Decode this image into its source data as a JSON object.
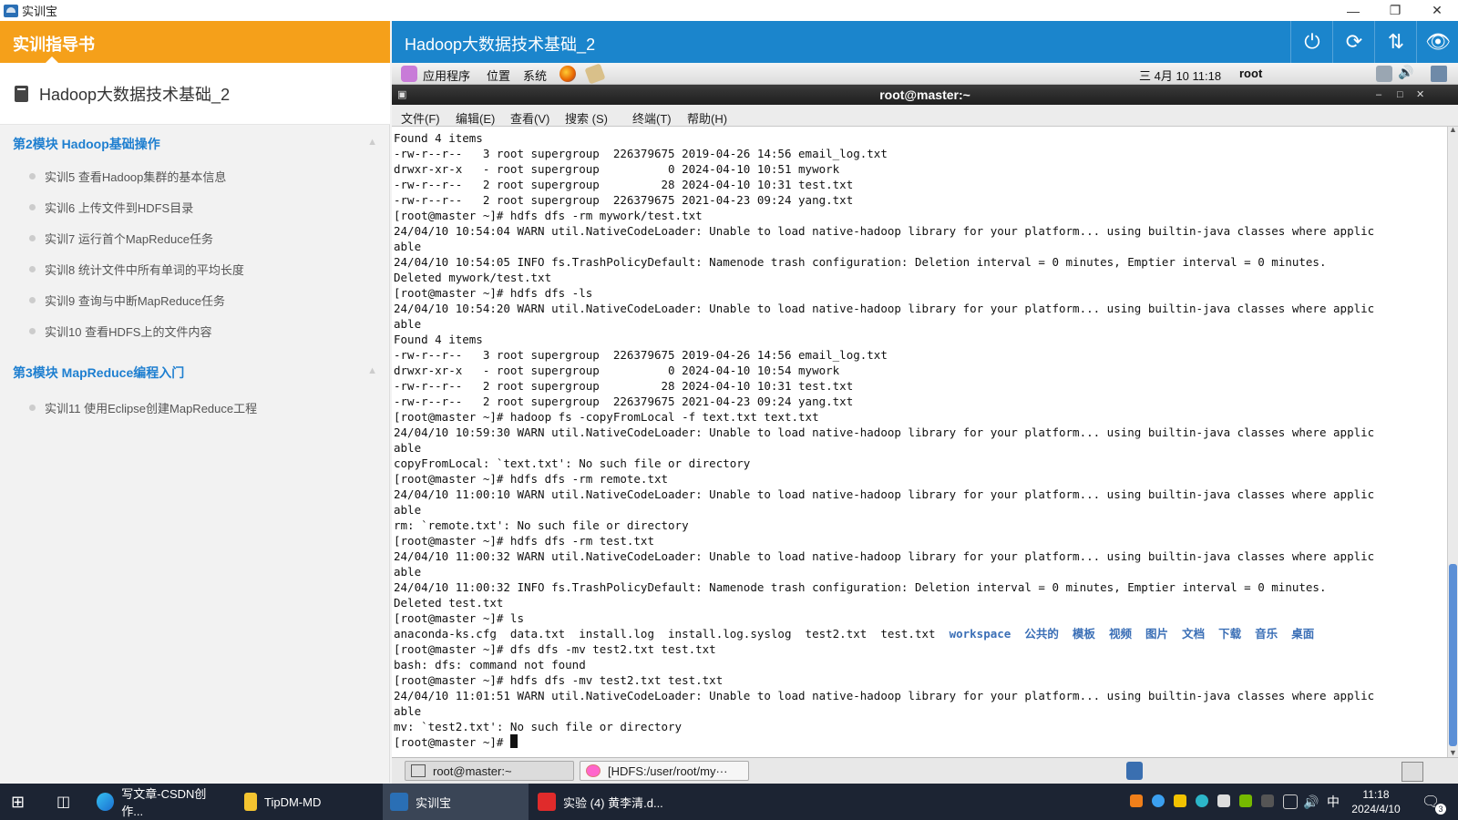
{
  "window": {
    "title": "实训宝"
  },
  "guide": {
    "header": "实训指导书",
    "doc_title": "Hadoop大数据技术基础_2",
    "modules": [
      {
        "title": "第2模块 Hadoop基础操作",
        "lessons": [
          "实训5 查看Hadoop集群的基本信息",
          "实训6 上传文件到HDFS目录",
          "实训7 运行首个MapReduce任务",
          "实训8 统计文件中所有单词的平均长度",
          "实训9 查询与中断MapReduce任务",
          "实训10 查看HDFS上的文件内容"
        ]
      },
      {
        "title": "第3模块 MapReduce编程入门",
        "lessons": [
          "实训11 使用Eclipse创建MapReduce工程"
        ]
      }
    ]
  },
  "vm": {
    "title": "Hadoop大数据技术基础_2"
  },
  "gnome_panel": {
    "apps": "应用程序",
    "places": "位置",
    "system": "系统",
    "datetime": "三 4月 10 11:18",
    "user": "root"
  },
  "terminal": {
    "title": "root@master:~",
    "menu": [
      "文件(F)",
      "编辑(E)",
      "查看(V)",
      "搜索 (S)",
      "终端(T)",
      "帮助(H)"
    ],
    "lines": [
      "Found 4 items",
      "-rw-r--r--   3 root supergroup  226379675 2019-04-26 14:56 email_log.txt",
      "drwxr-xr-x   - root supergroup          0 2024-04-10 10:51 mywork",
      "-rw-r--r--   2 root supergroup         28 2024-04-10 10:31 test.txt",
      "-rw-r--r--   2 root supergroup  226379675 2021-04-23 09:24 yang.txt",
      "[root@master ~]# hdfs dfs -rm mywork/test.txt",
      "24/04/10 10:54:04 WARN util.NativeCodeLoader: Unable to load native-hadoop library for your platform... using builtin-java classes where applic",
      "able",
      "24/04/10 10:54:05 INFO fs.TrashPolicyDefault: Namenode trash configuration: Deletion interval = 0 minutes, Emptier interval = 0 minutes.",
      "Deleted mywork/test.txt",
      "[root@master ~]# hdfs dfs -ls",
      "24/04/10 10:54:20 WARN util.NativeCodeLoader: Unable to load native-hadoop library for your platform... using builtin-java classes where applic",
      "able",
      "Found 4 items",
      "-rw-r--r--   3 root supergroup  226379675 2019-04-26 14:56 email_log.txt",
      "drwxr-xr-x   - root supergroup          0 2024-04-10 10:54 mywork",
      "-rw-r--r--   2 root supergroup         28 2024-04-10 10:31 test.txt",
      "-rw-r--r--   2 root supergroup  226379675 2021-04-23 09:24 yang.txt",
      "[root@master ~]# hadoop fs -copyFromLocal -f text.txt text.txt",
      "24/04/10 10:59:30 WARN util.NativeCodeLoader: Unable to load native-hadoop library for your platform... using builtin-java classes where applic",
      "able",
      "copyFromLocal: `text.txt': No such file or directory",
      "[root@master ~]# hdfs dfs -rm remote.txt",
      "24/04/10 11:00:10 WARN util.NativeCodeLoader: Unable to load native-hadoop library for your platform... using builtin-java classes where applic",
      "able",
      "rm: `remote.txt': No such file or directory",
      "[root@master ~]# hdfs dfs -rm test.txt",
      "24/04/10 11:00:32 WARN util.NativeCodeLoader: Unable to load native-hadoop library for your platform... using builtin-java classes where applic",
      "able",
      "24/04/10 11:00:32 INFO fs.TrashPolicyDefault: Namenode trash configuration: Deletion interval = 0 minutes, Emptier interval = 0 minutes.",
      "Deleted test.txt",
      "[root@master ~]# ls"
    ],
    "ls_plain": "anaconda-ks.cfg  data.txt  install.log  install.log.syslog  test2.txt  test.txt  ",
    "ls_dirs": "workspace  公共的  模板  视频  图片  文档  下载  音乐  桌面",
    "lines2": [
      "[root@master ~]# dfs dfs -mv test2.txt test.txt",
      "bash: dfs: command not found",
      "[root@master ~]# hdfs dfs -mv test2.txt test.txt",
      "24/04/10 11:01:51 WARN util.NativeCodeLoader: Unable to load native-hadoop library for your platform... using builtin-java classes where applic",
      "able",
      "mv: `test2.txt': No such file or directory"
    ],
    "prompt": "[root@master ~]# "
  },
  "gnome_bottom": {
    "tasks": [
      "root@master:~",
      "[HDFS:/user/root/my···"
    ]
  },
  "taskbar": {
    "apps": [
      "写文章-CSDN创作...",
      "TipDM-MD",
      "实训宝",
      "实验 (4) 黄李清.d..."
    ],
    "ime": "中",
    "time": "11:18",
    "date": "2024/4/10",
    "notify_count": "3"
  }
}
